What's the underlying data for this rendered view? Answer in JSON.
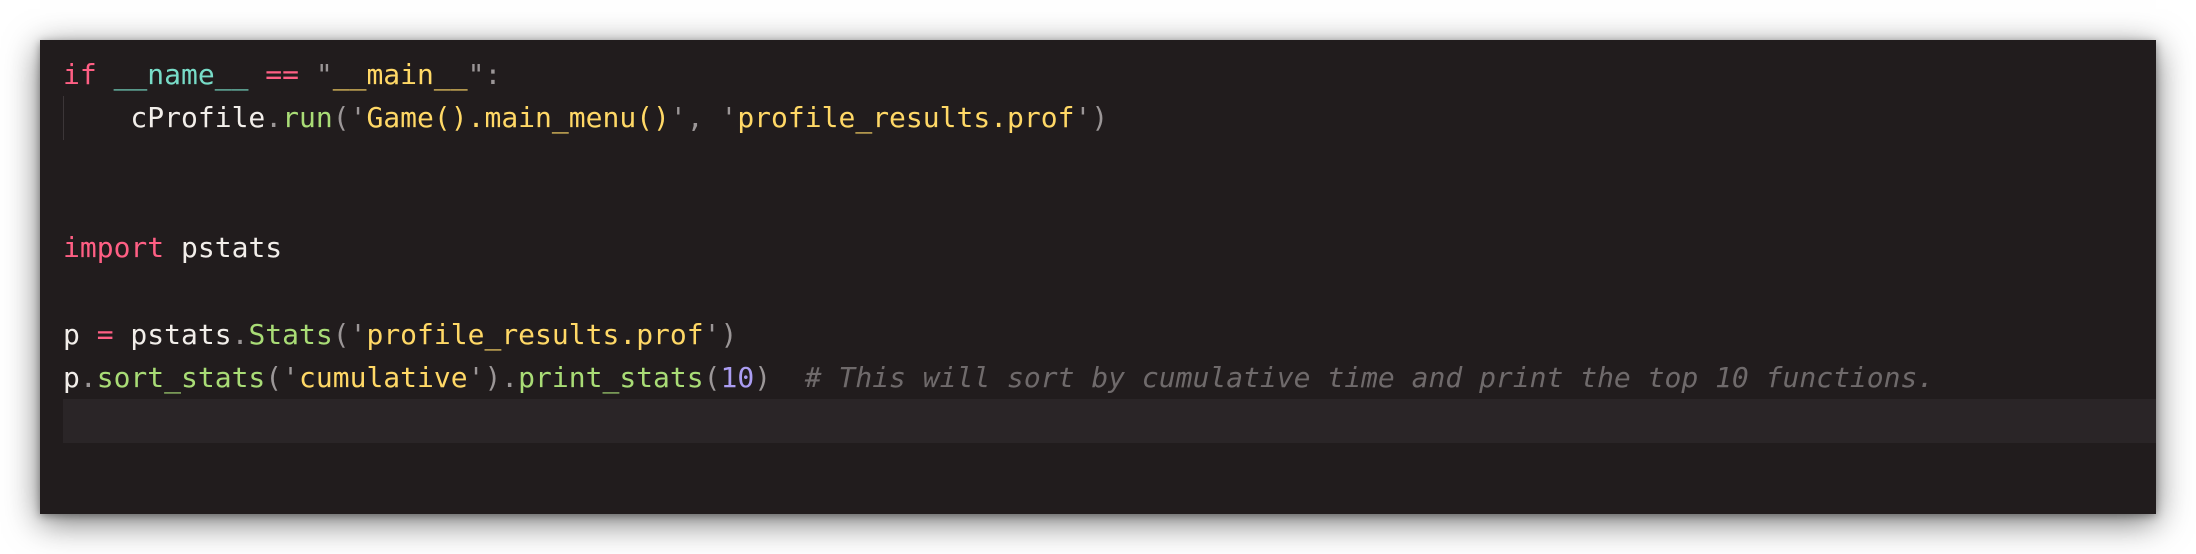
{
  "editor": {
    "language": "python",
    "theme_colors": {
      "background": "#211c1d",
      "current_line": "#2a2527",
      "keyword": "#ff5f84",
      "dunder": "#78dcc8",
      "string": "#ffd866",
      "function": "#a9dc76",
      "number": "#ab9df2",
      "comment": "#6f6a6b",
      "identifier": "#f2eeea"
    },
    "lines": [
      {
        "tokens": [
          {
            "type": "kw",
            "text": "if"
          },
          {
            "type": "id",
            "text": " "
          },
          {
            "type": "dunder",
            "text": "__name__"
          },
          {
            "type": "id",
            "text": " "
          },
          {
            "type": "op",
            "text": "=="
          },
          {
            "type": "id",
            "text": " "
          },
          {
            "type": "quote",
            "text": "\""
          },
          {
            "type": "str",
            "text": "__main__"
          },
          {
            "type": "quote",
            "text": "\""
          },
          {
            "type": "punc",
            "text": ":"
          }
        ]
      },
      {
        "indent_guide": true,
        "tokens": [
          {
            "type": "id",
            "text": "    cProfile"
          },
          {
            "type": "punc",
            "text": "."
          },
          {
            "type": "fn",
            "text": "run"
          },
          {
            "type": "punc",
            "text": "("
          },
          {
            "type": "quote",
            "text": "'"
          },
          {
            "type": "str",
            "text": "Game().main_menu()"
          },
          {
            "type": "quote",
            "text": "'"
          },
          {
            "type": "punc",
            "text": ", "
          },
          {
            "type": "quote",
            "text": "'"
          },
          {
            "type": "str",
            "text": "profile_results.prof"
          },
          {
            "type": "quote",
            "text": "'"
          },
          {
            "type": "punc",
            "text": ")"
          }
        ]
      },
      {
        "tokens": []
      },
      {
        "tokens": []
      },
      {
        "tokens": [
          {
            "type": "kw",
            "text": "import"
          },
          {
            "type": "id",
            "text": " pstats"
          }
        ]
      },
      {
        "tokens": []
      },
      {
        "tokens": [
          {
            "type": "id",
            "text": "p "
          },
          {
            "type": "op",
            "text": "="
          },
          {
            "type": "id",
            "text": " pstats"
          },
          {
            "type": "punc",
            "text": "."
          },
          {
            "type": "fn",
            "text": "Stats"
          },
          {
            "type": "punc",
            "text": "("
          },
          {
            "type": "quote",
            "text": "'"
          },
          {
            "type": "str",
            "text": "profile_results.prof"
          },
          {
            "type": "quote",
            "text": "'"
          },
          {
            "type": "punc",
            "text": ")"
          }
        ]
      },
      {
        "tokens": [
          {
            "type": "id",
            "text": "p"
          },
          {
            "type": "punc",
            "text": "."
          },
          {
            "type": "fn",
            "text": "sort_stats"
          },
          {
            "type": "punc",
            "text": "("
          },
          {
            "type": "quote",
            "text": "'"
          },
          {
            "type": "str",
            "text": "cumulative"
          },
          {
            "type": "quote",
            "text": "'"
          },
          {
            "type": "punc",
            "text": ")."
          },
          {
            "type": "fn",
            "text": "print_stats"
          },
          {
            "type": "punc",
            "text": "("
          },
          {
            "type": "num",
            "text": "10"
          },
          {
            "type": "punc",
            "text": ")"
          },
          {
            "type": "id",
            "text": "  "
          },
          {
            "type": "cmt",
            "text": "# This will sort by cumulative time and print the top 10 functions."
          }
        ]
      },
      {
        "current": true,
        "tokens": []
      }
    ]
  }
}
